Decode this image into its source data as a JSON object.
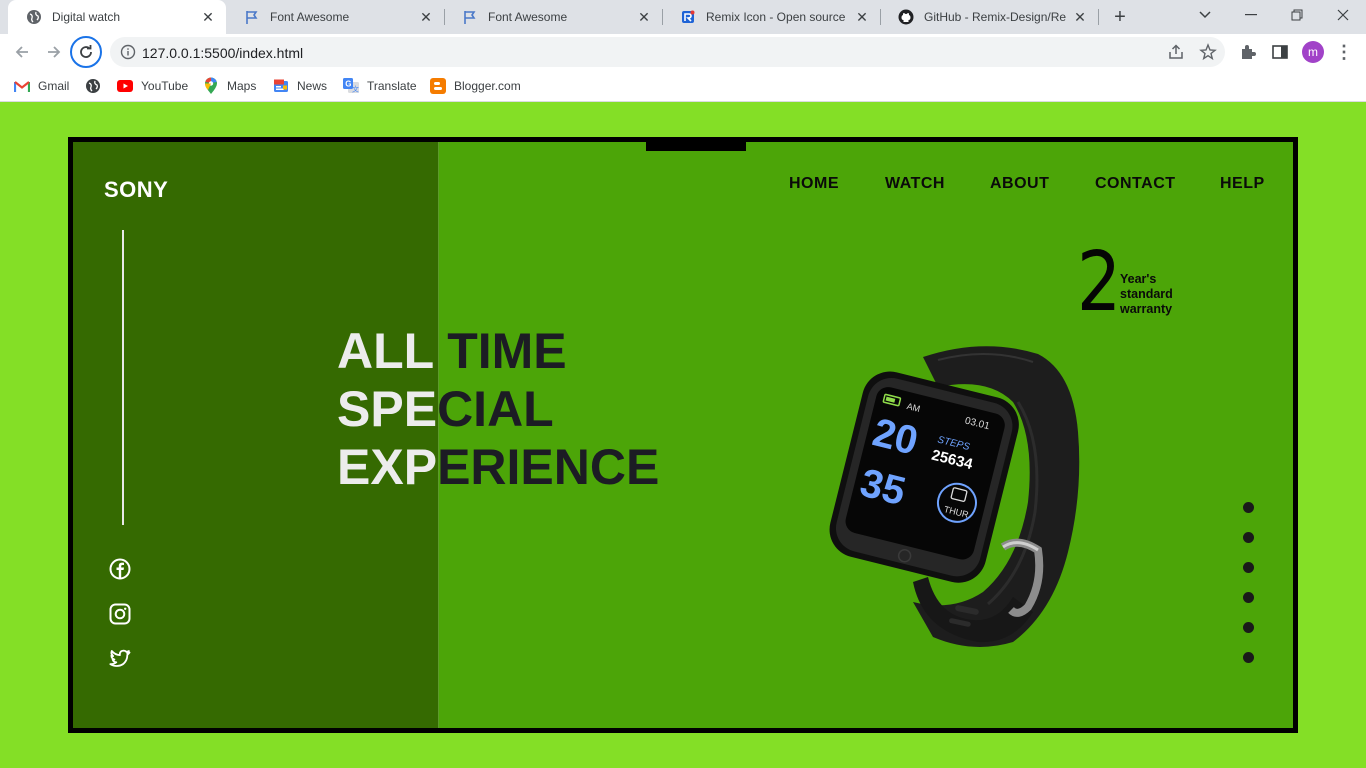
{
  "browser": {
    "tabs": [
      {
        "title": "Digital watch",
        "icon": "globe-icon",
        "active": true
      },
      {
        "title": "Font Awesome",
        "icon": "flag-icon",
        "active": false
      },
      {
        "title": "Font Awesome",
        "icon": "flag-icon",
        "active": false
      },
      {
        "title": "Remix Icon - Open source icon",
        "icon": "remix-icon",
        "active": false
      },
      {
        "title": "GitHub - Remix-Design/Remix",
        "icon": "github-icon",
        "active": false
      }
    ],
    "url": "127.0.0.1:5500/index.html",
    "avatar_letter": "m",
    "bookmarks": [
      {
        "label": "Gmail",
        "icon": "gmail-icon"
      },
      {
        "label": "",
        "icon": "globe-icon"
      },
      {
        "label": "YouTube",
        "icon": "youtube-icon"
      },
      {
        "label": "Maps",
        "icon": "maps-icon"
      },
      {
        "label": "News",
        "icon": "news-icon"
      },
      {
        "label": "Translate",
        "icon": "translate-icon"
      },
      {
        "label": "Blogger.com",
        "icon": "blogger-icon"
      }
    ]
  },
  "page": {
    "brand": "SONY",
    "nav": [
      "HOME",
      "WATCH",
      "ABOUT",
      "CONTACT",
      "HELP"
    ],
    "headline": {
      "line1_white": "ALL ",
      "line1_dark": "TIME",
      "line2_white": "SPE",
      "line2_dark": "CIAL",
      "line3_white": "EXP",
      "line3_dark": "ERIENCE"
    },
    "warranty": {
      "number": "2",
      "line1": "Year's",
      "line2": "standard",
      "line3": "warranty"
    },
    "watch_screen": {
      "time_hour": "20",
      "time_min": "35",
      "ampm": "AM",
      "date": "03.01",
      "steps_label": "STEPS",
      "steps": "25634",
      "day": "THUR"
    },
    "social": [
      "facebook-icon",
      "instagram-icon",
      "twitter-icon"
    ],
    "slider_dots": 6
  },
  "colors": {
    "page_bg": "#84df26",
    "frame_bg": "#4ca508",
    "left_panel": "#356a01",
    "headline_dark": "#1c1c24",
    "headline_light": "#ececec"
  }
}
